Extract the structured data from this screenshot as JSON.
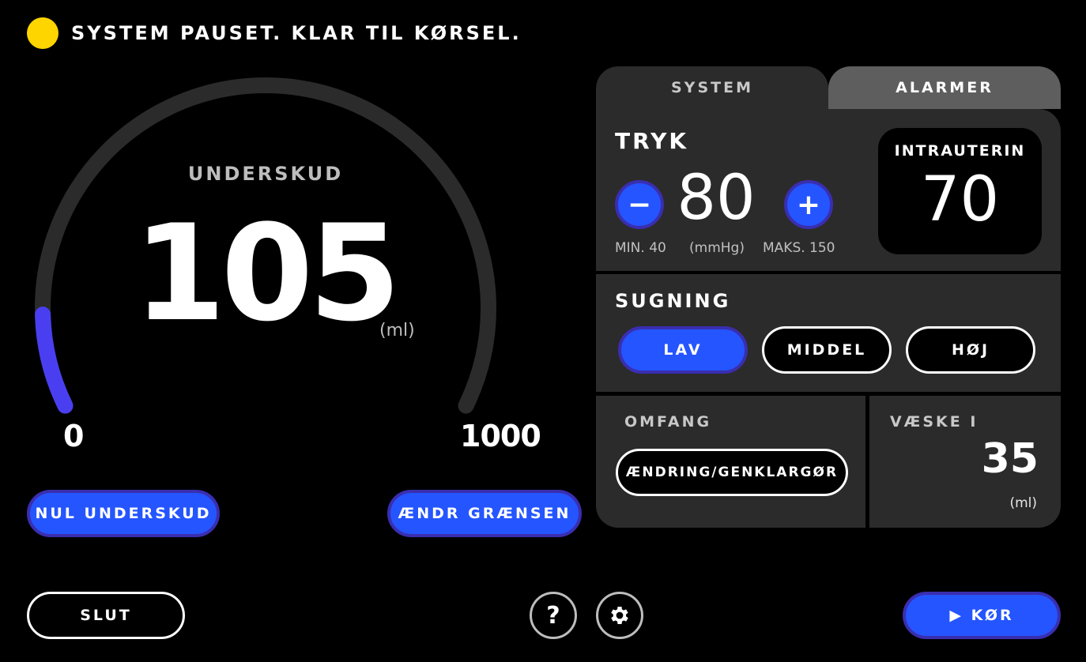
{
  "status": {
    "text": "SYSTEM PAUSET. KLAR TIL KØRSEL.",
    "indicator_color": "#ffd500"
  },
  "gauge": {
    "title": "UNDERSKUD",
    "value": "105",
    "unit": "(ml)",
    "min_label": "0",
    "max_label": "1000",
    "value_number": 105,
    "min": 0,
    "max": 1000,
    "track_color": "#2b2b2b",
    "fill_color": "#4a3ff0"
  },
  "buttons": {
    "zero_deficit": "NUL UNDERSKUD",
    "change_limit": "ÆNDR GRÆNSEN",
    "end": "SLUT",
    "run": "▶ KØR",
    "help_glyph": "?"
  },
  "panel": {
    "tabs": {
      "system": "SYSTEM",
      "alarms": "ALARMER"
    },
    "pressure": {
      "title": "TRYK",
      "value": "80",
      "minus": "−",
      "plus": "+",
      "min_label": "MIN. 40",
      "unit": "(mmHg)",
      "max_label": "MAKS. 150",
      "intrauterine_label": "INTRAUTERIN",
      "intrauterine_value": "70"
    },
    "suction": {
      "title": "SUGNING",
      "options": [
        "LAV",
        "MIDDEL",
        "HØJ"
      ],
      "selected": "LAV"
    },
    "scope": {
      "title": "OMFANG",
      "button": "ÆNDRING/GENKLARGØR"
    },
    "fluid": {
      "title": "VÆSKE I",
      "value": "35",
      "unit": "(ml)"
    }
  },
  "colors": {
    "accent": "#2455ff",
    "accent_border": "#3a2eb0",
    "panel_bg": "#2b2b2b",
    "status_yellow": "#ffd500"
  }
}
